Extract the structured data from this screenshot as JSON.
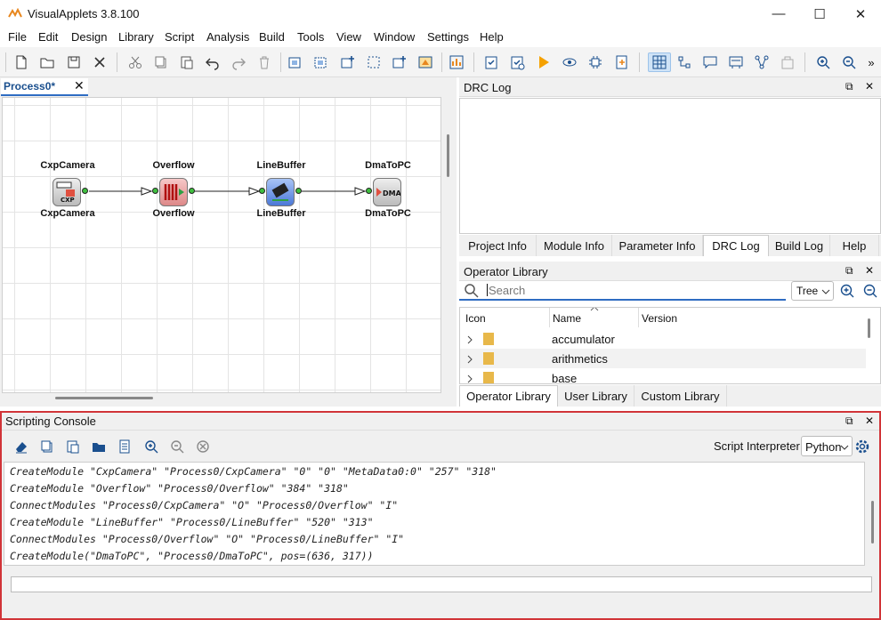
{
  "window": {
    "title": "VisualApplets 3.8.100",
    "minimize": "—",
    "maximize": "☐",
    "close": "✕"
  },
  "menu": [
    "File",
    "Edit",
    "Design",
    "Library",
    "Script",
    "Analysis",
    "Build",
    "Tools",
    "View",
    "Window",
    "Settings",
    "Help"
  ],
  "toolbar": {
    "overflow": "»"
  },
  "process_tab": {
    "label": "Process0*",
    "close": "✕"
  },
  "modules": [
    {
      "name_top": "CxpCamera",
      "name_bottom": "CxpCamera",
      "icon": "camera-cxp-icon"
    },
    {
      "name_top": "Overflow",
      "name_bottom": "Overflow",
      "icon": "overflow-icon"
    },
    {
      "name_top": "LineBuffer",
      "name_bottom": "LineBuffer",
      "icon": "linebuffer-icon"
    },
    {
      "name_top": "DmaToPC",
      "name_bottom": "DmaToPC",
      "icon": "dma-icon"
    }
  ],
  "drc_panel": {
    "title": "DRC Log"
  },
  "info_tabs": [
    "Project Info",
    "Module Info",
    "Parameter Info",
    "DRC Log",
    "Build Log",
    "Help"
  ],
  "info_tabs_selected": "DRC Log",
  "operator_library": {
    "title": "Operator Library",
    "search_placeholder": "Search",
    "view_mode": "Tree",
    "columns": [
      "Icon",
      "Name",
      "Version"
    ],
    "rows": [
      {
        "name": "accumulator",
        "version": ""
      },
      {
        "name": "arithmetics",
        "version": ""
      },
      {
        "name": "base",
        "version": ""
      }
    ],
    "tabs": [
      "Operator Library",
      "User Library",
      "Custom Library"
    ],
    "selected_tab": "Operator Library"
  },
  "console": {
    "title": "Scripting Console",
    "interpreter_label": "Script Interpreter",
    "interpreter_value": "Python",
    "lines": [
      "CreateModule \"CxpCamera\" \"Process0/CxpCamera\" \"0\" \"0\" \"MetaData0:0\" \"257\" \"318\"",
      "CreateModule \"Overflow\" \"Process0/Overflow\" \"384\" \"318\"",
      "ConnectModules \"Process0/CxpCamera\" \"O\" \"Process0/Overflow\" \"I\"",
      "CreateModule \"LineBuffer\" \"Process0/LineBuffer\" \"520\" \"313\"",
      "ConnectModules \"Process0/Overflow\" \"O\" \"Process0/LineBuffer\" \"I\"",
      "CreateModule(\"DmaToPC\", \"Process0/DmaToPC\", pos=(636, 317))"
    ],
    "input_value": ""
  },
  "colors": {
    "accent": "#2e6cc2",
    "console_border": "#d13438",
    "port": "#3fbf3f"
  }
}
